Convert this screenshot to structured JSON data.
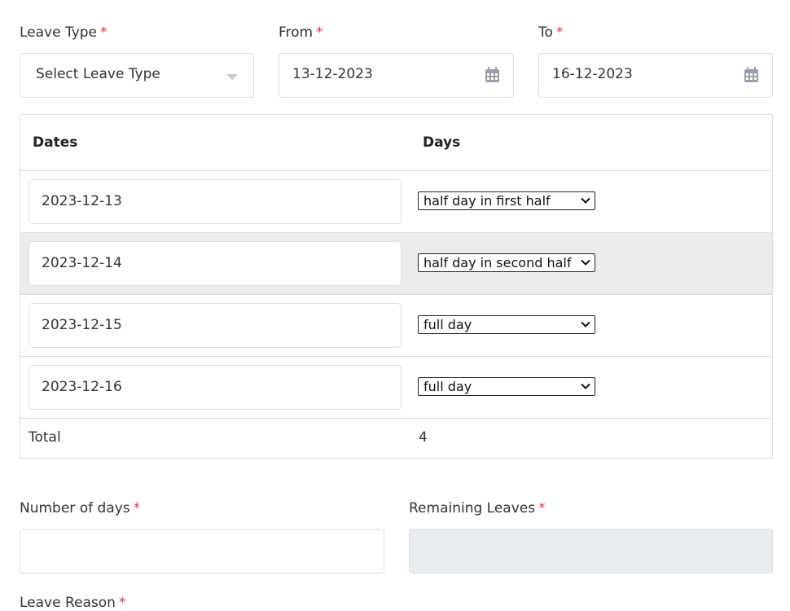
{
  "leave_type": {
    "label": "Leave Type",
    "placeholder": "Select Leave Type"
  },
  "from": {
    "label": "From",
    "value": "13-12-2023"
  },
  "to": {
    "label": "To",
    "value": "16-12-2023"
  },
  "required_mark": "*",
  "table": {
    "headers": {
      "dates": "Dates",
      "days": "Days"
    },
    "rows": [
      {
        "date": "2023-12-13",
        "day_type": "half day in first half"
      },
      {
        "date": "2023-12-14",
        "day_type": "half day in second half"
      },
      {
        "date": "2023-12-15",
        "day_type": "full day"
      },
      {
        "date": "2023-12-16",
        "day_type": "full day"
      }
    ],
    "total_label": "Total",
    "total_value": "4"
  },
  "number_of_days": {
    "label": "Number of days",
    "value": ""
  },
  "remaining_leaves": {
    "label": "Remaining Leaves",
    "value": ""
  },
  "leave_reason": {
    "label": "Leave Reason"
  },
  "colors": {
    "required": "#e8324a",
    "row_alt": "#ececec",
    "disabled_field": "#e9ecef"
  },
  "icons": {
    "calendar": "calendar-icon",
    "dropdown": "caret-down-icon"
  }
}
